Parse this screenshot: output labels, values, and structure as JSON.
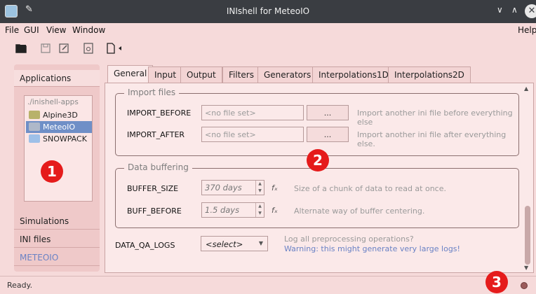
{
  "window": {
    "title": "INIshell for MeteoIO",
    "min": "∨",
    "max": "∧",
    "close": "✕"
  },
  "menu": {
    "file": "File",
    "gui": "GUI",
    "view": "View",
    "window": "Window",
    "help": "Help"
  },
  "sidebar": {
    "tabs": [
      "Applications",
      "Simulations",
      "INI files",
      "METEOIO"
    ],
    "list_header": "./inishell-apps",
    "apps": [
      "Alpine3D",
      "MeteoIO",
      "SNOWPACK"
    ]
  },
  "tabs": [
    "General",
    "Input",
    "Output",
    "Filters",
    "Generators",
    "Interpolations1D",
    "Interpolations2D"
  ],
  "import_files": {
    "legend": "Import files",
    "before_label": "IMPORT_BEFORE",
    "before_placeholder": "<no file set>",
    "before_btn": "...",
    "before_hint": "Import another ini file before everything else",
    "after_label": "IMPORT_AFTER",
    "after_placeholder": "<no file set>",
    "after_btn": "...",
    "after_hint": "Import another ini file after everything else."
  },
  "buffering": {
    "legend": "Data buffering",
    "size_label": "BUFFER_SIZE",
    "size_value": "370 days",
    "size_hint": "Size of a chunk of data to read at once.",
    "before_label": "BUFF_BEFORE",
    "before_value": "1.5 days",
    "before_hint": "Alternate way of buffer centering.",
    "fx": "fₓ"
  },
  "qa": {
    "label": "DATA_QA_LOGS",
    "select": "<select>",
    "hint": "Log all preprocessing operations?",
    "warning": "Warning: this might generate very large logs!"
  },
  "badges": [
    "1",
    "2",
    "3"
  ],
  "status": {
    "text": "Ready."
  },
  "colors": {
    "accent": "#6f8fc7",
    "badge": "#e51b1b",
    "bg": "#f6dada"
  }
}
